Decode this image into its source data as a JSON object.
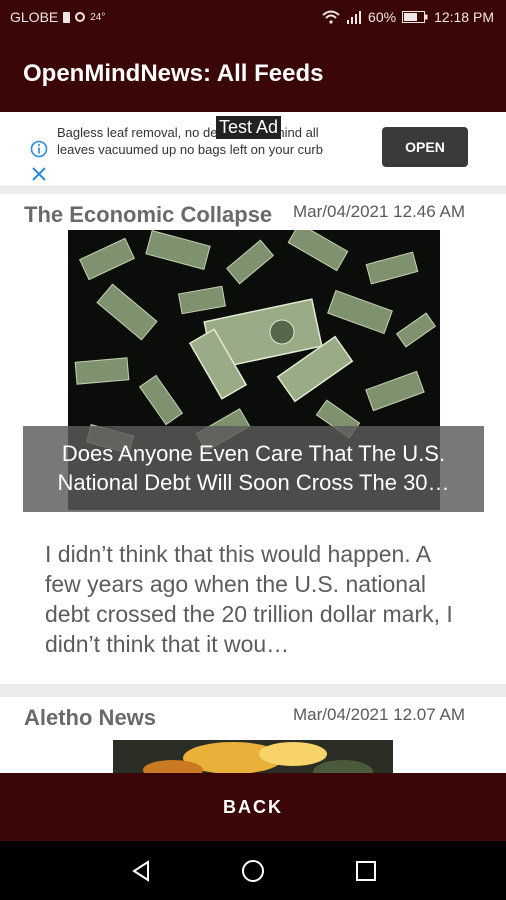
{
  "status_bar": {
    "carrier": "GLOBE",
    "temperature": "24°",
    "battery": "60%",
    "time": "12:18 PM"
  },
  "app_bar": {
    "title": "OpenMindNews: All Feeds"
  },
  "ad": {
    "text": "Bagless leaf removal, no debris left behind all leaves vacuumed up no bags left on your curb",
    "badge": "Test Ad",
    "open_label": "OPEN"
  },
  "feeds": [
    {
      "source": "The Economic Collapse",
      "date": "Mar/04/2021 12.46 AM",
      "headline": "Does Anyone Even Care That The U.S. National Debt Will Soon Cross The 30…",
      "summary": "I didn’t think that this would happen. A few years ago when the U.S. national debt crossed the 20 trillion dollar mark, I didn’t think that it wou…"
    },
    {
      "source": "Aletho News",
      "date": "Mar/04/2021 12.07 AM"
    }
  ],
  "bottom": {
    "back_label": "BACK"
  }
}
